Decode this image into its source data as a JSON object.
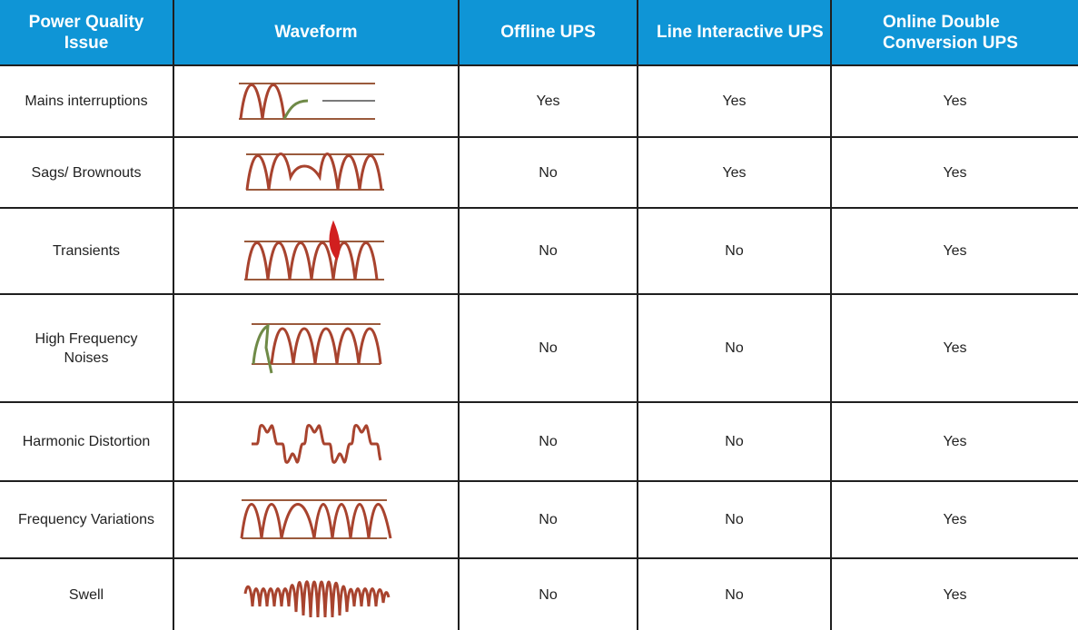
{
  "table": {
    "headers": {
      "issue": "Power Quality Issue",
      "waveform": "Waveform",
      "offline": "Offline UPS",
      "line_interactive": "Line Interactive UPS",
      "online": "Online Double Conversion UPS"
    },
    "rows": [
      {
        "issue": "Mains interruptions",
        "waveform_icon": "interruption-waveform-icon",
        "offline": "Yes",
        "line_interactive": "Yes",
        "online": "Yes"
      },
      {
        "issue": "Sags/ Brownouts",
        "waveform_icon": "sag-waveform-icon",
        "offline": "No",
        "line_interactive": "Yes",
        "online": "Yes"
      },
      {
        "issue": "Transients",
        "waveform_icon": "transient-waveform-icon",
        "offline": "No",
        "line_interactive": "No",
        "online": "Yes"
      },
      {
        "issue": "High Frequency Noises",
        "waveform_icon": "noise-waveform-icon",
        "offline": "No",
        "line_interactive": "No",
        "online": "Yes"
      },
      {
        "issue": "Harmonic Distortion",
        "waveform_icon": "harmonic-waveform-icon",
        "offline": "No",
        "line_interactive": "No",
        "online": "Yes"
      },
      {
        "issue": "Frequency Variations",
        "waveform_icon": "frequency-variation-waveform-icon",
        "offline": "No",
        "line_interactive": "No",
        "online": "Yes"
      },
      {
        "issue": "Swell",
        "waveform_icon": "swell-waveform-icon",
        "offline": "No",
        "line_interactive": "No",
        "online": "Yes"
      }
    ]
  },
  "colors": {
    "header_bg": "#0f95d6",
    "header_text": "#ffffff",
    "wave_stroke": "#a8432e",
    "wave_guide": "#9a5a3c",
    "transient_spike": "#d11f1f",
    "noise_start": "#6f8a47",
    "grid_line": "#1f1f1f"
  }
}
